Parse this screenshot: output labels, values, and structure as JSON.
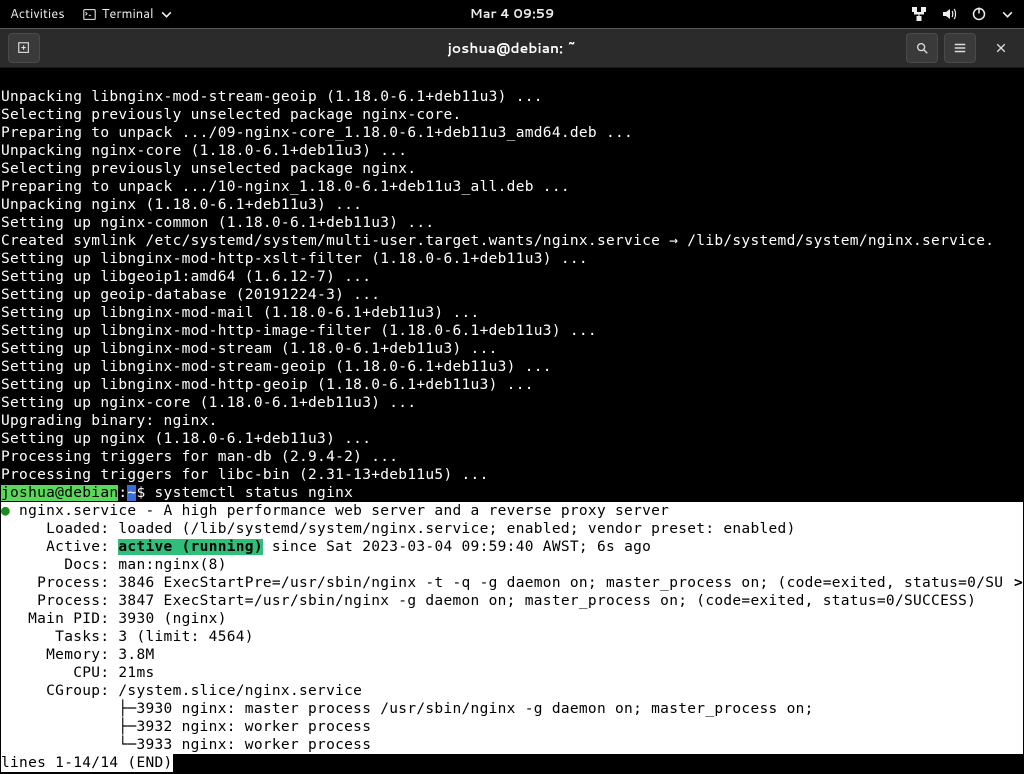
{
  "topbar": {
    "activities": "Activities",
    "terminal_label": "Terminal",
    "clock": "Mar 4  09:59"
  },
  "window": {
    "title": "joshua@debian: ~"
  },
  "output_lines": [
    "Unpacking libnginx-mod-stream-geoip (1.18.0-6.1+deb11u3) ...",
    "Selecting previously unselected package nginx-core.",
    "Preparing to unpack .../09-nginx-core_1.18.0-6.1+deb11u3_amd64.deb ...",
    "Unpacking nginx-core (1.18.0-6.1+deb11u3) ...",
    "Selecting previously unselected package nginx.",
    "Preparing to unpack .../10-nginx_1.18.0-6.1+deb11u3_all.deb ...",
    "Unpacking nginx (1.18.0-6.1+deb11u3) ...",
    "Setting up nginx-common (1.18.0-6.1+deb11u3) ...",
    "Created symlink /etc/systemd/system/multi-user.target.wants/nginx.service → /lib/systemd/system/nginx.service.",
    "Setting up libnginx-mod-http-xslt-filter (1.18.0-6.1+deb11u3) ...",
    "Setting up libgeoip1:amd64 (1.6.12-7) ...",
    "Setting up geoip-database (20191224-3) ...",
    "Setting up libnginx-mod-mail (1.18.0-6.1+deb11u3) ...",
    "Setting up libnginx-mod-http-image-filter (1.18.0-6.1+deb11u3) ...",
    "Setting up libnginx-mod-stream (1.18.0-6.1+deb11u3) ...",
    "Setting up libnginx-mod-stream-geoip (1.18.0-6.1+deb11u3) ...",
    "Setting up libnginx-mod-http-geoip (1.18.0-6.1+deb11u3) ...",
    "Setting up nginx-core (1.18.0-6.1+deb11u3) ...",
    "Upgrading binary: nginx.",
    "Setting up nginx (1.18.0-6.1+deb11u3) ...",
    "Processing triggers for man-db (2.9.4-2) ...",
    "Processing triggers for libc-bin (2.31-13+deb11u5) ..."
  ],
  "prompt": {
    "user": "joshua@debian",
    "path": "~",
    "command": "systemctl status nginx"
  },
  "status": {
    "header": " nginx.service - A high performance web server and a reverse proxy server",
    "loaded": "     Loaded: loaded (/lib/systemd/system/nginx.service; enabled; vendor preset: enabled)",
    "active_label": "     Active: ",
    "active_value": "active (running)",
    "active_rest": " since Sat 2023-03-04 09:59:40 AWST; 6s ago",
    "docs": "       Docs: man:nginx(8)",
    "process1": "    Process: 3846 ExecStartPre=/usr/sbin/nginx -t -q -g daemon on; master_process on; (code=exited, status=0/SU",
    "process2": "    Process: 3847 ExecStart=/usr/sbin/nginx -g daemon on; master_process on; (code=exited, status=0/SUCCESS)",
    "mainpid": "   Main PID: 3930 (nginx)",
    "tasks": "      Tasks: 3 (limit: 4564)",
    "memory": "     Memory: 3.8M",
    "cpu": "        CPU: 21ms",
    "cgroup": "     CGroup: /system.slice/nginx.service",
    "tree1": "             ├─3930 nginx: master process /usr/sbin/nginx -g daemon on; master_process on;",
    "tree2": "             ├─3932 nginx: worker process",
    "tree3": "             └─3933 nginx: worker process",
    "scroll_indicator": ">"
  },
  "pager": "lines 1-14/14 (END)"
}
